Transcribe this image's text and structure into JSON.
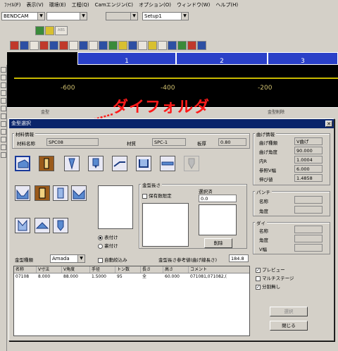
{
  "menu": [
    "ﾌｧｲﾙ(F)",
    "表示(V)",
    "環境(E)",
    "工程(Q)",
    "Camエンジン(C)",
    "オプション(O)",
    "ウィンドウ(W)",
    "ヘルプ(H)"
  ],
  "toolbar": {
    "machine": "BENDCAM",
    "setup": "Setup1",
    "abs_label": "ABS"
  },
  "canvas": {
    "tabs": [
      "1",
      "2",
      "3"
    ],
    "axis": [
      "-600",
      "-400",
      "-200"
    ]
  },
  "status": {
    "left": "金型",
    "right": "金型削除"
  },
  "annotation": "ダイフォルダ",
  "dialog": {
    "title": "金型選択",
    "material": {
      "group": "材料情報",
      "name_label": "材料名称",
      "name_value": "SPC08",
      "mat_label": "材質",
      "mat_value": "SPC-1",
      "thick_label": "板厚",
      "thick_value": "0.80"
    },
    "bend": {
      "group": "曲げ情報",
      "rows": [
        {
          "label": "曲げ種類",
          "value": "V曲げ"
        },
        {
          "label": "曲げ角度",
          "value": "90.000"
        },
        {
          "label": "内R",
          "value": "1.0004"
        },
        {
          "label": "参照V幅",
          "value": "6.000"
        },
        {
          "label": "伸び値",
          "value": "1.4858"
        }
      ]
    },
    "punch": {
      "group": "パンチ",
      "rows": [
        {
          "label": "名称"
        },
        {
          "label": "角度"
        }
      ]
    },
    "die": {
      "group": "ダイ",
      "rows": [
        {
          "label": "名称"
        },
        {
          "label": "角度"
        },
        {
          "label": "V幅"
        }
      ]
    },
    "length": {
      "group": "金型長さ",
      "fixed_label": "保有数限定",
      "selected_label": "選択済",
      "selected_value": "0.0",
      "delete_button": "削除"
    },
    "orient": {
      "forward": "表付け",
      "reverse": "裏付け"
    },
    "type_label": "金型種類",
    "type_value": "Amada",
    "auto_label": "自動絞込み",
    "ref_label": "金型長さ参考値(曲げ線長さ)",
    "ref_value": "184.8",
    "table": {
      "headers": [
        "名称",
        "V寸法",
        "V角度",
        "手径",
        "トン数",
        "長さ",
        "高さ",
        "コメント"
      ],
      "rows": [
        [
          "07108",
          "8.000",
          "88.000",
          "1.5000",
          "95",
          "全",
          "60.000",
          "071081,071082,("
        ]
      ]
    },
    "options": [
      {
        "label": "プレビュー",
        "checked": true
      },
      {
        "label": "マルチステージ",
        "checked": false
      },
      {
        "label": "分割無し",
        "checked": true
      }
    ],
    "select_button": "選択",
    "close_button": "閉じる"
  }
}
